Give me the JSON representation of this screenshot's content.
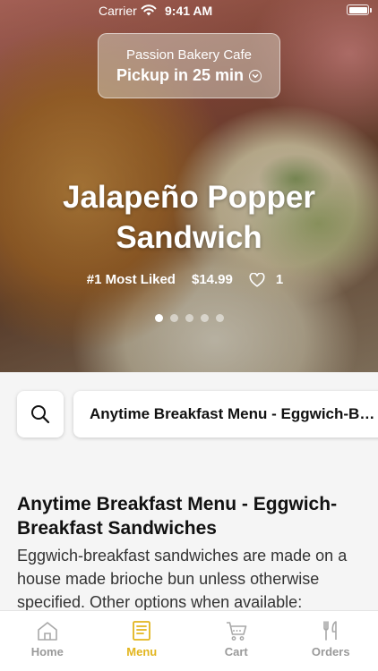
{
  "status_bar": {
    "carrier": "Carrier",
    "time": "9:41 AM"
  },
  "store": {
    "name": "Passion Bakery Cafe",
    "pickup": "Pickup in 25 min"
  },
  "featured_item": {
    "title_line1": "Jalapeño Popper",
    "title_line2": "Sandwich",
    "rank": "#1 Most Liked",
    "price": "$14.99",
    "likes": "1",
    "carousel": {
      "count": 5,
      "active_index": 0
    }
  },
  "search": {
    "icon": "search-icon"
  },
  "category": {
    "label": "Anytime Breakfast Menu - Eggwich-Breakfast Sandwiches"
  },
  "section": {
    "title": "Anytime Breakfast Menu - Eggwich-Breakfast Sandwiches",
    "description": "Eggwich-breakfast sandwiches are made on a house made brioche bun unless otherwise specified. Other options when available:"
  },
  "tabs": [
    {
      "label": "Home",
      "icon": "home-icon",
      "active": false
    },
    {
      "label": "Menu",
      "icon": "menu-icon",
      "active": true
    },
    {
      "label": "Cart",
      "icon": "cart-icon",
      "active": false
    },
    {
      "label": "Orders",
      "icon": "orders-icon",
      "active": false
    }
  ],
  "colors": {
    "accent": "#e2b51d",
    "inactive": "#9a9a9a"
  }
}
